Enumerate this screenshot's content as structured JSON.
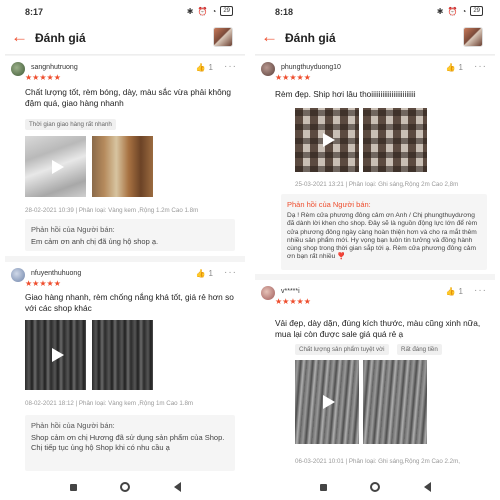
{
  "colors": {
    "accent": "#ee4d2d",
    "background": "#f4f4f4"
  },
  "left": {
    "status": {
      "time": "8:17",
      "battery": "29"
    },
    "header": {
      "title": "Đánh giá"
    },
    "reviews": [
      {
        "username": "sangnhutruong",
        "likes": "1",
        "stars": "★★★★★",
        "text": "Chất lượng tốt, rèm bóng, dày, màu sắc vừa phải không đậm quá, giao hàng nhanh",
        "tags": [
          "Thời gian giao hàng rất nhanh"
        ],
        "meta": "28-02-2021 10:39 | Phân loại: Vàng kem ,Rộng 1.2m Cao 1.8m",
        "reply_title": "Phản hồi của Người bán:",
        "reply_text": "Em cảm ơn anh chị đã ủng hộ shop ạ."
      },
      {
        "username": "nfuyenthuhuong",
        "likes": "1",
        "stars": "★★★★★",
        "text": "Giao hàng nhanh, rèm chống nắng khá tốt, giá rẻ hơn so với các shop khác",
        "tags": [],
        "meta": "08-02-2021 18:12 | Phân loại: Vàng kem ,Rộng 1m Cao 1.8m",
        "reply_title": "Phản hồi của Người bán:",
        "reply_text": "Shop cảm ơn chị Hương đã sử dụng sản phẩm của Shop. Chị tiếp tục ủng hộ Shop khi có nhu cầu ạ"
      }
    ]
  },
  "right": {
    "status": {
      "time": "8:18",
      "battery": "29"
    },
    "header": {
      "title": "Đánh giá"
    },
    "reviews": [
      {
        "username": "phungthuyduong10",
        "likes": "1",
        "stars": "★★★★★",
        "text": "Rèm đẹp. Ship hơi lâu thoiiiiiiiiiiiiiiiiiiiiiiii",
        "tags": [],
        "meta": "25-03-2021 13:21 | Phân loại: Ghi sáng,Rộng 2m Cao 2,8m",
        "reply_title": "Phản hồi của Người bán:",
        "reply_text": "Dạ ! Rèm cửa phương đông cảm ơn Anh / Chị phungthuydương đã dành lời khen cho shop. Đây sẽ là nguồn động lực lớn để rèm cửa phương đông ngày càng hoàn thiện hơn và cho ra mắt thêm nhiều sản phẩm mới. Hy vọng bạn luôn tin tưởng và đồng hành cùng shop trong thời gian sắp tới ạ. Rèm cửa phương đông cảm ơn bạn rất nhiều ❣️"
      },
      {
        "username": "v*****i",
        "likes": "1",
        "stars": "★★★★★",
        "text": "Vải đẹp, dày dặn, đúng kích thước, màu cũng xinh nữa, mua lại còn được sale giá quá rẻ ạ",
        "tags": [
          "Chất lượng sản phẩm tuyệt vời",
          "Rất đáng tiền"
        ],
        "meta": "06-03-2021 10:01 | Phân loại: Ghi sáng,Rộng 2m Cao 2.2m,"
      }
    ]
  }
}
